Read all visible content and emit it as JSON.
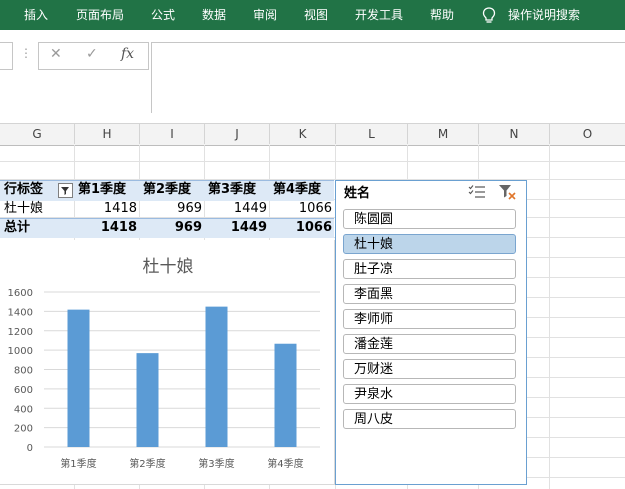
{
  "ribbon": {
    "tabs": [
      "插入",
      "页面布局",
      "公式",
      "数据",
      "审阅",
      "视图",
      "开发工具",
      "帮助"
    ],
    "search_label": "操作说明搜索"
  },
  "formula_bar": {
    "fx_label": "fx",
    "cancel_icon": "✕",
    "enter_icon": "✓"
  },
  "columns": [
    "G",
    "H",
    "I",
    "J",
    "K",
    "L",
    "M",
    "N",
    "O"
  ],
  "pivot": {
    "row_label_header": "行标签",
    "quarter_headers": [
      "第1季度",
      "第2季度",
      "第3季度",
      "第4季度"
    ],
    "rows": [
      {
        "name": "杜十娘",
        "values": [
          "1418",
          "969",
          "1449",
          "1066"
        ]
      }
    ],
    "total": {
      "name": "总计",
      "values": [
        "1418",
        "969",
        "1449",
        "1066"
      ]
    }
  },
  "chart_data": {
    "type": "bar",
    "title": "杜十娘",
    "categories": [
      "第1季度",
      "第2季度",
      "第3季度",
      "第4季度"
    ],
    "values": [
      1418,
      969,
      1449,
      1066
    ],
    "ylim": [
      0,
      1600
    ],
    "yticks": [
      "0",
      "200",
      "400",
      "600",
      "800",
      "1000",
      "1200",
      "1400",
      "1600"
    ],
    "grid": true,
    "bar_color": "#5b9bd5"
  },
  "slicer": {
    "title": "姓名",
    "items": [
      "陈圆圆",
      "杜十娘",
      "肚子凉",
      "李面黑",
      "李师师",
      "潘金莲",
      "万财迷",
      "尹泉水",
      "周八皮"
    ],
    "selected": "杜十娘"
  },
  "colors": {
    "ribbon": "#217346",
    "pivot_header": "#dde9f6",
    "slicer_selected": "#bcd5ea"
  }
}
